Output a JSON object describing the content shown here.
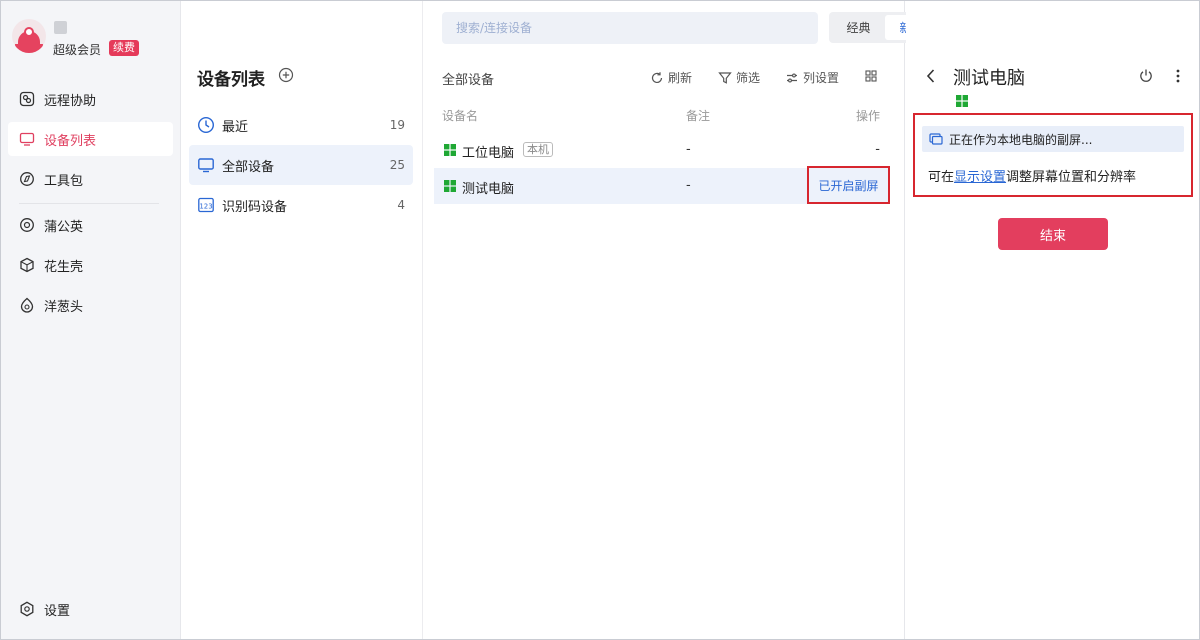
{
  "colors": {
    "accent": "#e04060",
    "link": "#2a67d4",
    "highlight_border": "#d7262f",
    "selected_bg": "#edf2fb",
    "windows_green": "#1fa834"
  },
  "profile": {
    "member_label": "超级会员",
    "renew_badge": "续费"
  },
  "sidebar": {
    "items": [
      {
        "label": "远程协助",
        "icon": "remote-assist-icon"
      },
      {
        "label": "设备列表",
        "icon": "device-list-icon"
      },
      {
        "label": "工具包",
        "icon": "toolkit-icon"
      },
      {
        "label": "蒲公英",
        "icon": "dandelion-icon"
      },
      {
        "label": "花生壳",
        "icon": "peanut-shell-icon"
      },
      {
        "label": "洋葱头",
        "icon": "onion-icon"
      }
    ],
    "settings_label": "设置"
  },
  "groups": {
    "title": "设备列表",
    "items": [
      {
        "label": "最近",
        "count": "19",
        "icon": "clock-icon"
      },
      {
        "label": "全部设备",
        "count": "25",
        "icon": "monitor-icon"
      },
      {
        "label": "识别码设备",
        "count": "4",
        "icon": "id-code-icon"
      }
    ]
  },
  "search": {
    "placeholder": "搜索/连接设备"
  },
  "view_toggle": {
    "classic": "经典",
    "new": "新版",
    "selected": "新版"
  },
  "device_list": {
    "title": "全部设备",
    "toolbar": {
      "refresh": "刷新",
      "filter": "筛选",
      "columns": "列设置"
    },
    "columns": {
      "name": "设备名",
      "note": "备注",
      "action": "操作"
    },
    "rows": [
      {
        "name": "工位电脑",
        "tag": "本机",
        "note": "-",
        "action": "-"
      },
      {
        "name": "测试电脑",
        "note": "-",
        "action": "已开启副屏"
      }
    ]
  },
  "detail": {
    "title": "测试电脑",
    "status": "正在作为本地电脑的副屏...",
    "hint_prefix": "可在",
    "hint_link": "显示设置",
    "hint_suffix": "调整屏幕位置和分辨率",
    "end_button": "结束"
  }
}
